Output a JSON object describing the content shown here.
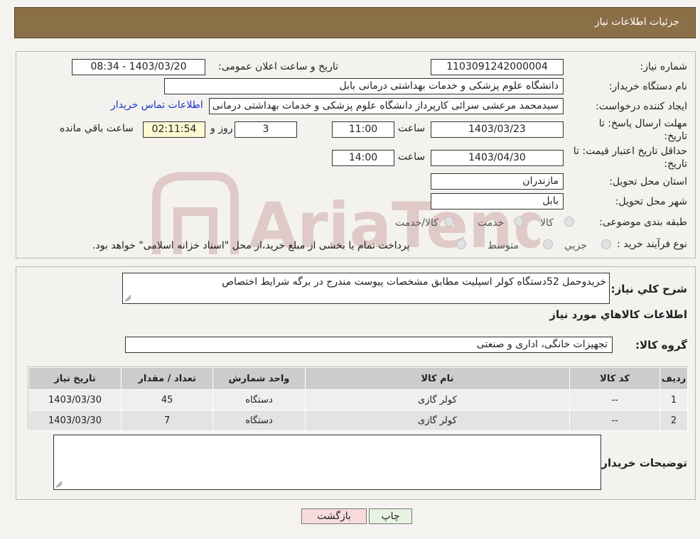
{
  "header": {
    "title": "جزئیات اطلاعات نیاز"
  },
  "form": {
    "need_number_label": "شماره نیاز:",
    "need_number": "1103091242000004",
    "announce_label": "تاریخ و ساعت اعلان عمومی:",
    "announce_value": "1403/03/20 - 08:34",
    "buyer_org_label": "نام دستگاه خریدار:",
    "buyer_org": "دانشگاه علوم پزشکی و خدمات بهداشتی  درمانی بابل",
    "creator_label": "ایجاد کننده درخواست:",
    "creator": "سیدمحمد مرعشی سرائی کارپرداز دانشگاه علوم پزشکی و خدمات بهداشتی  درمانی بابل",
    "contact_link": "اطلاعات تماس خریدار",
    "deadline_label_1": "مهلت ارسال پاسخ: تا",
    "deadline_label_2": "تاریخ:",
    "deadline_date": "1403/03/23",
    "time_label": "ساعت",
    "deadline_time": "11:00",
    "days_value": "3",
    "days_label": "روز و",
    "remaining_time": "02:11:54",
    "remaining_label": "ساعت باقي مانده",
    "min_validity_label_1": "حداقل تاریخ اعتبار قیمت: تا",
    "min_validity_label_2": "تاریخ:",
    "validity_date": "1403/04/30",
    "validity_time": "14:00",
    "province_label": "استان محل تحویل:",
    "province": "مازندران",
    "city_label": "شهر محل تحویل:",
    "city": "بابل",
    "category_label": "طبقه بندی موضوعی:",
    "category_options": [
      "کالا",
      "خدمت",
      "کالا/خدمت"
    ],
    "purchase_type_label": "نوع فرآیند خرید :",
    "purchase_options": [
      "جزیي",
      "متوسط"
    ],
    "purchase_note": "پرداخت تمام یا بخشی از مبلغ خرید،از محل \"اسناد خزانه اسلامی\" خواهد بود."
  },
  "details": {
    "description_label": "شرح کلي نياز:",
    "description": "خریدوحمل 52دستگاه کولر اسپلیت مطابق مشخصات پیوست مندرج در برگه شرایط اختصاص",
    "goods_info_title": "اطلاعات کالاهاي مورد نياز",
    "goods_group_label": "گروه کالا:",
    "goods_group": "تجهیزات خانگی، اداری و صنعتی",
    "table": {
      "headers": [
        "رديف",
        "کد کالا",
        "نام کالا",
        "واحد شمارش",
        "تعداد / مقدار",
        "تاریخ نیاز"
      ],
      "rows": [
        [
          "1",
          "--",
          "کولر گازی",
          "دستگاه",
          "45",
          "1403/03/30"
        ],
        [
          "2",
          "--",
          "کولر گازی",
          "دستگاه",
          "7",
          "1403/03/30"
        ]
      ]
    },
    "buyer_notes_label": "توضیحات خریدار:"
  },
  "buttons": {
    "print": "چاپ",
    "back": "بازگشت"
  },
  "watermark": "AriaTender.neT"
}
